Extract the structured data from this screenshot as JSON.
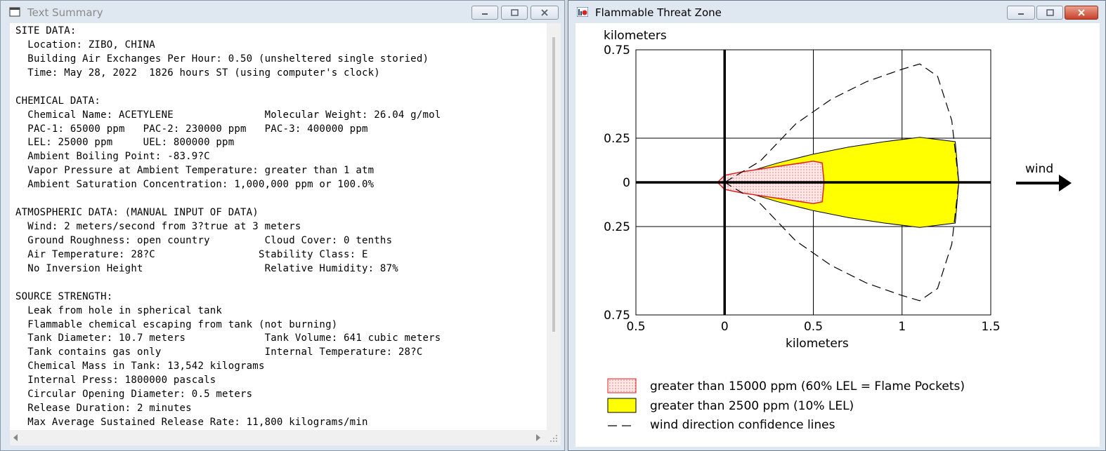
{
  "text_window": {
    "title": "Text Summary",
    "lines": [
      "SITE DATA:",
      "  Location: ZIBO, CHINA",
      "  Building Air Exchanges Per Hour: 0.50 (unsheltered single storied)",
      "  Time: May 28, 2022  1826 hours ST (using computer's clock)",
      "",
      "CHEMICAL DATA:",
      "  Chemical Name: ACETYLENE               Molecular Weight: 26.04 g/mol",
      "  PAC-1: 65000 ppm   PAC-2: 230000 ppm   PAC-3: 400000 ppm",
      "  LEL: 25000 ppm     UEL: 800000 ppm",
      "  Ambient Boiling Point: -83.9?C",
      "  Vapor Pressure at Ambient Temperature: greater than 1 atm",
      "  Ambient Saturation Concentration: 1,000,000 ppm or 100.0%",
      "",
      "ATMOSPHERIC DATA: (MANUAL INPUT OF DATA)",
      "  Wind: 2 meters/second from 3?true at 3 meters",
      "  Ground Roughness: open country         Cloud Cover: 0 tenths",
      "  Air Temperature: 28?C                 Stability Class: E",
      "  No Inversion Height                    Relative Humidity: 87%",
      "",
      "SOURCE STRENGTH:",
      "  Leak from hole in spherical tank",
      "  Flammable chemical escaping from tank (not burning)",
      "  Tank Diameter: 10.7 meters             Tank Volume: 641 cubic meters",
      "  Tank contains gas only                 Internal Temperature: 28?C",
      "  Chemical Mass in Tank: 13,542 kilograms",
      "  Internal Press: 1800000 pascals",
      "  Circular Opening Diameter: 0.5 meters",
      "  Release Duration: 2 minutes",
      "  Max Average Sustained Release Rate: 11,800 kilograms/min"
    ]
  },
  "threat_window": {
    "title": "Flammable Threat Zone",
    "wind_label": "wind",
    "legend": [
      {
        "label": "greater than 15000 ppm (60% LEL = Flame Pockets)",
        "color": "#ffd7d7",
        "edge": "#e02020"
      },
      {
        "label": "greater than 2500 ppm (10% LEL)",
        "color": "#ffff00",
        "edge": "#000000"
      },
      {
        "label": "wind direction confidence lines",
        "color": "none",
        "edge": "#000000"
      }
    ]
  },
  "chart_data": {
    "type": "area",
    "ylabel": "kilometers",
    "xlabel": "kilometers",
    "xlim": [
      -0.5,
      1.5
    ],
    "ylim": [
      -0.75,
      0.75
    ],
    "x_tick_labels": [
      "0.5",
      "0",
      "0.5",
      "1",
      "1.5"
    ],
    "y_tick_labels": [
      "0.75",
      "0.25",
      "0",
      "0.25",
      "0.75"
    ],
    "grid": true,
    "series": [
      {
        "name": "greater than 2500 ppm (10% LEL)",
        "boundary": [
          [
            0.0,
            0.0
          ],
          [
            0.1,
            0.05
          ],
          [
            0.3,
            0.11
          ],
          [
            0.5,
            0.16
          ],
          [
            0.7,
            0.2
          ],
          [
            0.9,
            0.23
          ],
          [
            1.1,
            0.255
          ],
          [
            1.3,
            0.23
          ],
          [
            1.32,
            0.0
          ],
          [
            1.3,
            -0.23
          ],
          [
            1.1,
            -0.255
          ],
          [
            0.9,
            -0.23
          ],
          [
            0.7,
            -0.2
          ],
          [
            0.5,
            -0.16
          ],
          [
            0.3,
            -0.11
          ],
          [
            0.1,
            -0.05
          ],
          [
            0.0,
            0.0
          ]
        ]
      },
      {
        "name": "greater than 15000 ppm (60% LEL = Flame Pockets)",
        "boundary": [
          [
            -0.04,
            0.0
          ],
          [
            0.0,
            0.04
          ],
          [
            0.1,
            0.06
          ],
          [
            0.3,
            0.09
          ],
          [
            0.5,
            0.12
          ],
          [
            0.55,
            0.11
          ],
          [
            0.56,
            0.0
          ],
          [
            0.55,
            -0.11
          ],
          [
            0.5,
            -0.12
          ],
          [
            0.3,
            -0.09
          ],
          [
            0.1,
            -0.06
          ],
          [
            0.0,
            -0.04
          ],
          [
            -0.04,
            0.0
          ]
        ]
      },
      {
        "name": "wind direction confidence lines",
        "boundary": [
          [
            0.0,
            0.0
          ],
          [
            0.2,
            0.12
          ],
          [
            0.4,
            0.33
          ],
          [
            0.6,
            0.47
          ],
          [
            0.8,
            0.57
          ],
          [
            1.0,
            0.64
          ],
          [
            1.1,
            0.67
          ],
          [
            1.2,
            0.6
          ],
          [
            1.28,
            0.35
          ],
          [
            1.32,
            0.0
          ],
          [
            1.28,
            -0.35
          ],
          [
            1.2,
            -0.6
          ],
          [
            1.1,
            -0.67
          ],
          [
            1.0,
            -0.64
          ],
          [
            0.8,
            -0.57
          ],
          [
            0.6,
            -0.47
          ],
          [
            0.4,
            -0.33
          ],
          [
            0.2,
            -0.12
          ],
          [
            0.0,
            0.0
          ]
        ]
      }
    ]
  }
}
